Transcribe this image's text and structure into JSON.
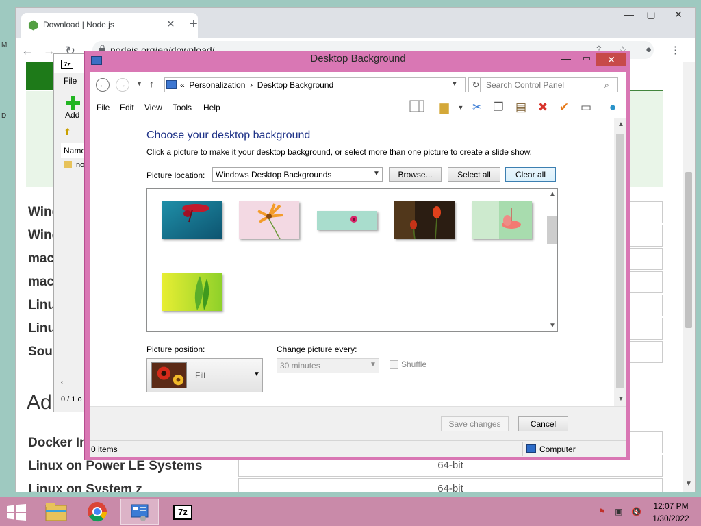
{
  "browser": {
    "tab_title": "Download | Node.js",
    "url": "nodejs.org/en/download/",
    "rows": [
      {
        "label": "Wind",
        "value": ""
      },
      {
        "label": "Wind",
        "value": ""
      },
      {
        "label": "mac",
        "value": ""
      },
      {
        "label": "mac",
        "value": ""
      },
      {
        "label": "Linu",
        "value": ""
      },
      {
        "label": "Linu",
        "value": ""
      },
      {
        "label": "Sour",
        "value": ""
      }
    ],
    "section_heading": "Add",
    "extra_rows": [
      {
        "label": "Docker Im",
        "value": ""
      },
      {
        "label": "Linux on Power LE Systems",
        "value": "64-bit"
      },
      {
        "label": "Linux on System z",
        "value": "64-bit"
      }
    ]
  },
  "sevenzip": {
    "icon_label": "7z",
    "menu_file": "File",
    "add_label": "Add",
    "col_name": "Name",
    "item": "no",
    "status": "0 / 1 o"
  },
  "window": {
    "title": "Desktop Background",
    "breadcrumb_prefix": "«",
    "breadcrumb_1": "Personalization",
    "breadcrumb_sep": "›",
    "breadcrumb_2": "Desktop Background",
    "search_placeholder": "Search Control Panel",
    "menu": [
      "File",
      "Edit",
      "View",
      "Tools",
      "Help"
    ],
    "heading": "Choose your desktop background",
    "description": "Click a picture to make it your desktop background, or select more than one picture to create a slide show.",
    "location_label": "Picture location:",
    "location_value": "Windows Desktop Backgrounds",
    "browse_label": "Browse...",
    "select_all_label": "Select all",
    "clear_all_label": "Clear all",
    "position_label": "Picture position:",
    "position_value": "Fill",
    "change_label": "Change picture every:",
    "change_value": "30 minutes",
    "shuffle_label": "Shuffle",
    "save_label": "Save changes",
    "cancel_label": "Cancel",
    "status_items": "0 items",
    "status_location": "Computer"
  },
  "taskbar": {
    "time": "12:07 PM",
    "date": "1/30/2022",
    "sevenzip_label": "7z"
  },
  "colors": {
    "window_frame": "#d977b4",
    "heading": "#1e3287",
    "taskbar": "#c98aa9",
    "close": "#c74a49"
  }
}
